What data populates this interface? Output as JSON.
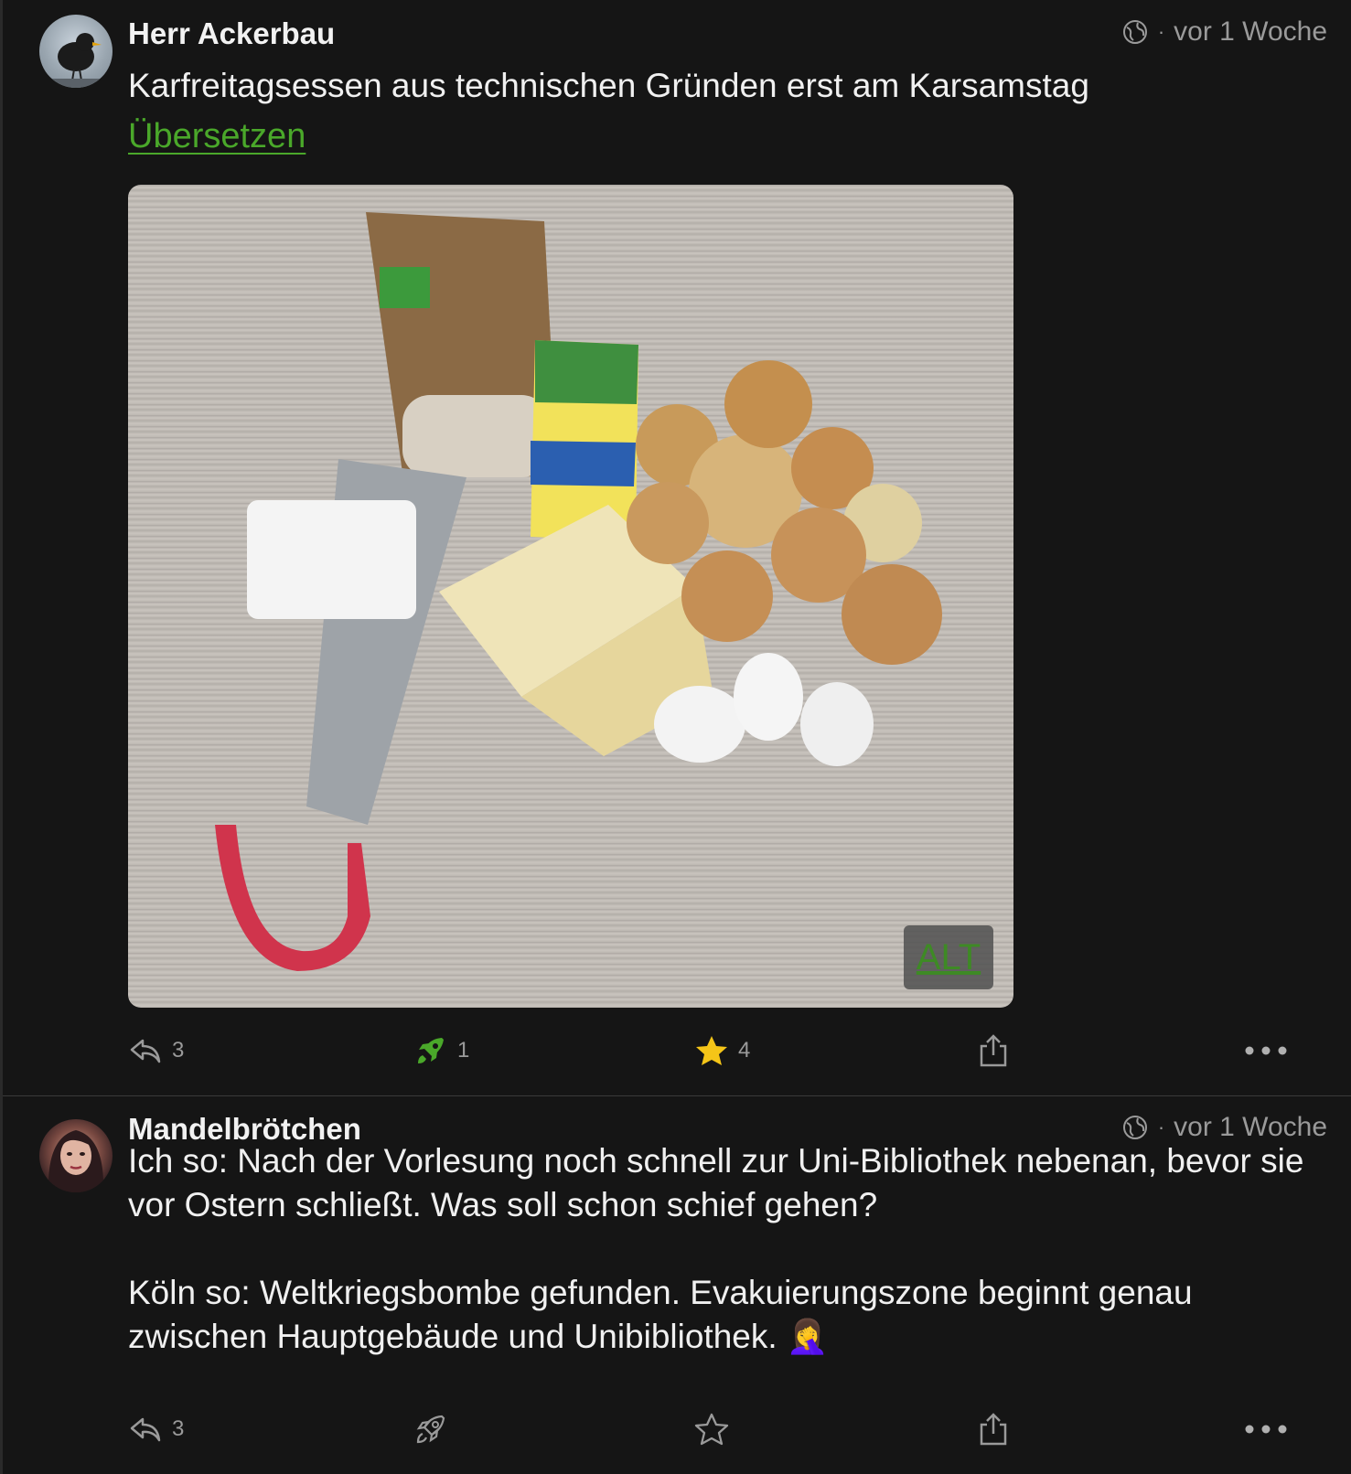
{
  "posts": [
    {
      "author": "Herr Ackerbau",
      "time": "vor 1 Woche",
      "dot": "·",
      "text": "Karfreitagsessen aus technischen Gründen erst am Karsamstag",
      "translate_label": "Übersetzen",
      "image": {
        "alt_label": "ALT"
      },
      "actions": {
        "replies": "3",
        "boosts": "1",
        "favourites": "4"
      },
      "icons": {
        "visibility": "globe-icon",
        "reply": "reply-icon",
        "boost": "rocket-icon",
        "favourite": "star-icon",
        "share": "share-icon",
        "more": "ellipsis-icon"
      },
      "colors": {
        "boost": "#4aa82a",
        "favourite": "#f5c518"
      }
    },
    {
      "author": "Mandelbrötchen",
      "time": "vor 1 Woche",
      "dot": "·",
      "text_paragraph_1": "Ich so: Nach der Vorlesung noch schnell zur Uni-Bibliothek nebenan, bevor sie vor Ostern schließt. Was soll schon schief gehen?",
      "text_paragraph_2": "Köln so: Weltkriegsbombe gefunden. Evakuierungszone beginnt genau zwischen Hauptgebäude und Unibibliothek. 🤦‍♀️",
      "actions": {
        "replies": "3"
      },
      "icons": {
        "visibility": "globe-icon",
        "reply": "reply-icon",
        "boost": "rocket-icon",
        "favourite": "star-outline-icon",
        "share": "share-icon",
        "more": "ellipsis-icon"
      }
    }
  ],
  "colors": {
    "background": "#151515",
    "link": "#4aa82a",
    "muted": "#9a9a9a"
  }
}
